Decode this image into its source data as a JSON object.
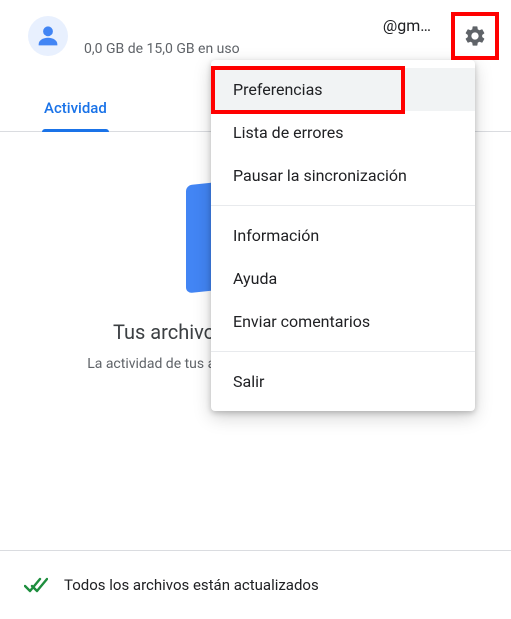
{
  "header": {
    "email": "@gm…",
    "storage": "0,0 GB de 15,0 GB en uso"
  },
  "tabs": {
    "activity": "Actividad"
  },
  "content": {
    "headline": "Tus archivos están actualizados",
    "subline": "La actividad de tus archivos y carpetas aparecerá aquí"
  },
  "footer": {
    "status": "Todos los archivos están actualizados"
  },
  "menu": {
    "preferences": "Preferencias",
    "error_list": "Lista de errores",
    "pause_sync": "Pausar la sincronización",
    "about": "Información",
    "help": "Ayuda",
    "feedback": "Enviar comentarios",
    "quit": "Salir"
  }
}
